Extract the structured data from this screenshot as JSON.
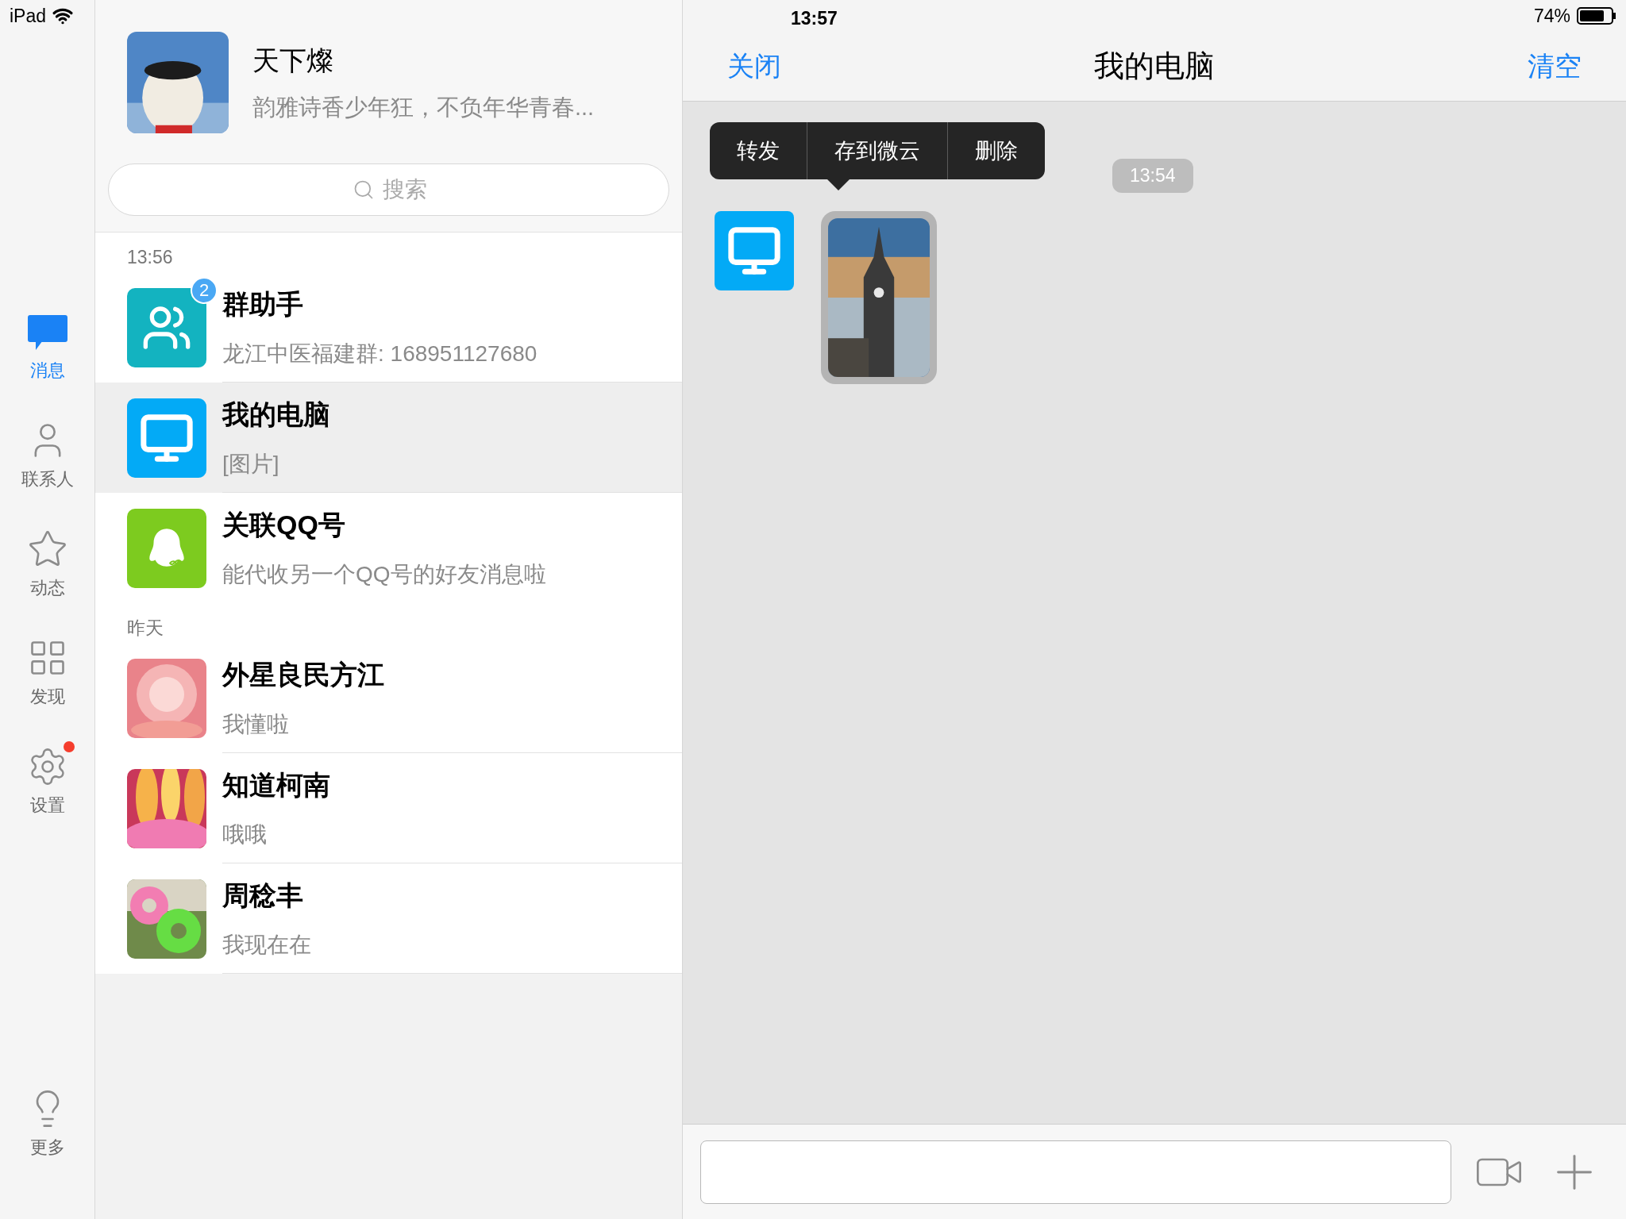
{
  "status_bar": {
    "carrier": "iPad",
    "time": "13:57",
    "battery": "74%"
  },
  "sidebar": {
    "tabs": [
      {
        "kind": "messages",
        "label": "消息",
        "selected": true,
        "dot": false
      },
      {
        "kind": "contacts",
        "label": "联系人",
        "selected": false,
        "dot": false
      },
      {
        "kind": "moments",
        "label": "动态",
        "selected": false,
        "dot": false
      },
      {
        "kind": "discover",
        "label": "发现",
        "selected": false,
        "dot": false
      },
      {
        "kind": "settings",
        "label": "设置",
        "selected": false,
        "dot": true
      }
    ],
    "more": {
      "kind": "more",
      "label": "更多"
    }
  },
  "profile": {
    "name": "天下燦",
    "signature": "韵雅诗香少年狂，不负年华青春..."
  },
  "search": {
    "placeholder": "搜索"
  },
  "sections": [
    {
      "heading": "13:56",
      "items": [
        {
          "kind": "group",
          "title": "群助手",
          "subtitle": "龙江中医福建群: 168951127680",
          "badge": "2",
          "selected": false
        },
        {
          "kind": "computer",
          "title": "我的电脑",
          "subtitle": "[图片]",
          "selected": true
        },
        {
          "kind": "qq",
          "title": "关联QQ号",
          "subtitle": "能代收另一个QQ号的好友消息啦",
          "selected": false
        }
      ]
    },
    {
      "heading": "昨天",
      "items": [
        {
          "kind": "glow",
          "title": "外星良民方江",
          "subtitle": "我懂啦",
          "selected": false
        },
        {
          "kind": "flower",
          "title": "知道柯南",
          "subtitle": "哦哦",
          "selected": false
        },
        {
          "kind": "rings",
          "title": "周稔丰",
          "subtitle": "我现在在",
          "selected": false
        }
      ]
    }
  ],
  "chat": {
    "close": "关闭",
    "title": "我的电脑",
    "clear": "清空",
    "menu": [
      "转发",
      "存到微云",
      "删除"
    ],
    "timestamp": "13:54"
  }
}
